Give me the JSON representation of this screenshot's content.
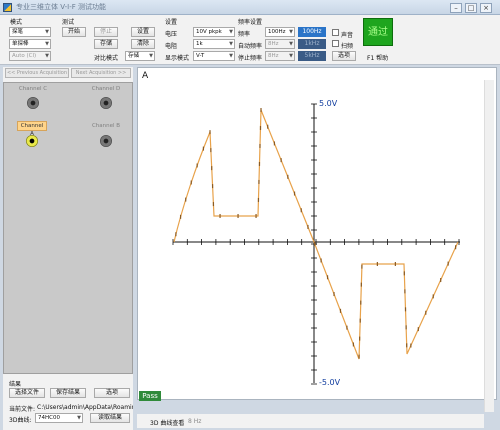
{
  "window": {
    "title": "专业三维立体 V-I-F 测试功能",
    "controls": [
      "–",
      "□",
      "×"
    ]
  },
  "mode": {
    "header": "模式",
    "pen_value": "探笔",
    "pen_options": [
      "探笔"
    ],
    "single_value": "单探棒",
    "auto_value": "Auto (Cl)"
  },
  "test": {
    "header": "测试",
    "start": "开始",
    "stop": "停止",
    "save": "存储",
    "compare_label": "对比模式",
    "compare_value": "存储",
    "setting": "设置",
    "clear": "清除"
  },
  "settings": {
    "header": "设置",
    "voltage_label": "电压",
    "voltage_value": "10V pkpk",
    "current_label": "电阻",
    "current_value": "1k",
    "display_label": "显示模式",
    "display_value": "V-T"
  },
  "freq": {
    "header": "频率设置",
    "freq_label": "频率",
    "freq_value": "100Hz",
    "freq_box": "100Hz",
    "auto_label": "自动频率",
    "auto_value": "8Hz",
    "auto_box": "1kHz",
    "stop_label": "停止频率",
    "stop_value": "8Hz",
    "stop_box": "5kHz",
    "sound_label": "声音",
    "scan_label": "扫频",
    "options": "选项",
    "help": "F1 帮助"
  },
  "pass_indicator": "通过",
  "nav": {
    "prev": "<< Previous Acquisition",
    "next": "Next Acquisition >>"
  },
  "channels": {
    "c": "Channel C",
    "d": "Channel D",
    "a": "Channel A",
    "b": "Channel B"
  },
  "results": {
    "header": "结果",
    "select_file": "选择文件",
    "save_result": "保存结果",
    "options": "选项",
    "current_file_label": "当前文件:",
    "current_file_path": "C:\\Users\\admin\\AppData\\Roaming\\Micr",
    "curve3d_label": "3D曲线:",
    "curve3d_value": "74HC00",
    "read_result": "读取结果"
  },
  "scope": {
    "channel": "A",
    "top_voltage": "5.0V",
    "bottom_voltage": "-5.0V",
    "status_badge": "Pass",
    "trace_color": "#e8a24a"
  },
  "status": {
    "curve_view": "3D 曲线查看",
    "freq": "8 Hz"
  }
}
